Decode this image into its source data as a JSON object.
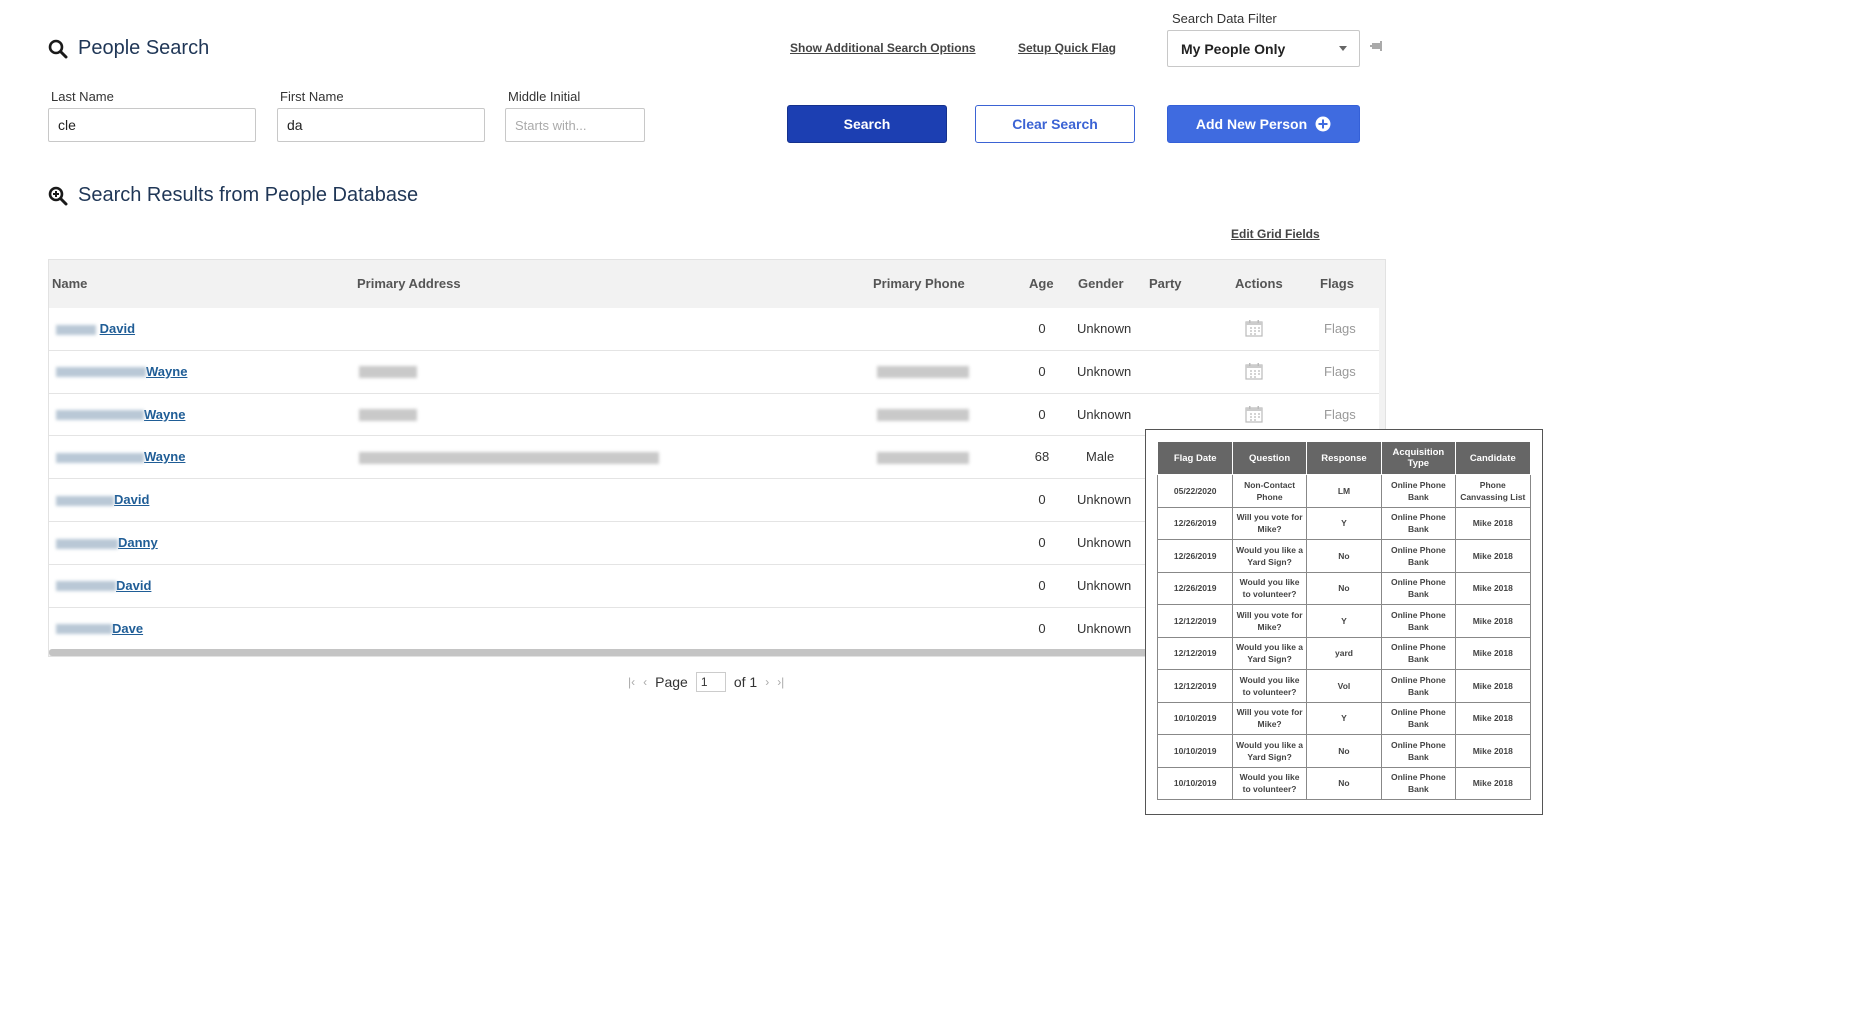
{
  "header": {
    "title": "People Search",
    "show_options_link": "Show Additional Search Options",
    "quick_flag_link": "Setup Quick Flag",
    "filter_label": "Search Data Filter",
    "filter_value": "My People Only"
  },
  "form": {
    "last_name_label": "Last Name",
    "last_name_value": "cle",
    "first_name_label": "First Name",
    "first_name_value": "da",
    "middle_initial_label": "Middle Initial",
    "middle_initial_placeholder": "Starts with...",
    "search_button": "Search",
    "clear_button": "Clear Search",
    "add_button": "Add New Person"
  },
  "results": {
    "title": "Search Results from People Database",
    "edit_grid_link": "Edit Grid Fields",
    "columns": [
      "Name",
      "Primary Address",
      "Primary Phone",
      "Age",
      "Gender",
      "Party",
      "Actions",
      "Flags"
    ],
    "rows": [
      {
        "name": "David",
        "age": "0",
        "gender": "Unknown",
        "flags": "Flags"
      },
      {
        "name": "Wayne",
        "age": "0",
        "gender": "Unknown",
        "flags": "Flags"
      },
      {
        "name": "Wayne",
        "age": "0",
        "gender": "Unknown",
        "flags": "Flags"
      },
      {
        "name": "Wayne",
        "age": "68",
        "gender": "Male",
        "flags": ""
      },
      {
        "name": "David",
        "age": "0",
        "gender": "Unknown",
        "flags": ""
      },
      {
        "name": "Danny",
        "age": "0",
        "gender": "Unknown",
        "flags": ""
      },
      {
        "name": "David",
        "age": "0",
        "gender": "Unknown",
        "flags": ""
      },
      {
        "name": "Dave",
        "age": "0",
        "gender": "Unknown",
        "flags": ""
      }
    ]
  },
  "pager": {
    "page_label": "Page",
    "page_value": "1",
    "of_label": "of 1"
  },
  "flags_popup": {
    "columns": [
      "Flag Date",
      "Question",
      "Response",
      "Acquisition Type",
      "Candidate"
    ],
    "rows": [
      [
        "05/22/2020",
        "Non-Contact Phone",
        "LM",
        "Online Phone Bank",
        "Phone Canvassing List"
      ],
      [
        "12/26/2019",
        "Will you vote for Mike?",
        "Y",
        "Online Phone Bank",
        "Mike 2018"
      ],
      [
        "12/26/2019",
        "Would you like a Yard Sign?",
        "No",
        "Online Phone Bank",
        "Mike 2018"
      ],
      [
        "12/26/2019",
        "Would you like to volunteer?",
        "No",
        "Online Phone Bank",
        "Mike 2018"
      ],
      [
        "12/12/2019",
        "Will you vote for Mike?",
        "Y",
        "Online Phone Bank",
        "Mike 2018"
      ],
      [
        "12/12/2019",
        "Would you like a Yard Sign?",
        "yard",
        "Online Phone Bank",
        "Mike 2018"
      ],
      [
        "12/12/2019",
        "Would you like to volunteer?",
        "Vol",
        "Online Phone Bank",
        "Mike 2018"
      ],
      [
        "10/10/2019",
        "Will you vote for Mike?",
        "Y",
        "Online Phone Bank",
        "Mike 2018"
      ],
      [
        "10/10/2019",
        "Would you like a Yard Sign?",
        "No",
        "Online Phone Bank",
        "Mike 2018"
      ],
      [
        "10/10/2019",
        "Would you like to volunteer?",
        "No",
        "Online Phone Bank",
        "Mike 2018"
      ]
    ]
  }
}
